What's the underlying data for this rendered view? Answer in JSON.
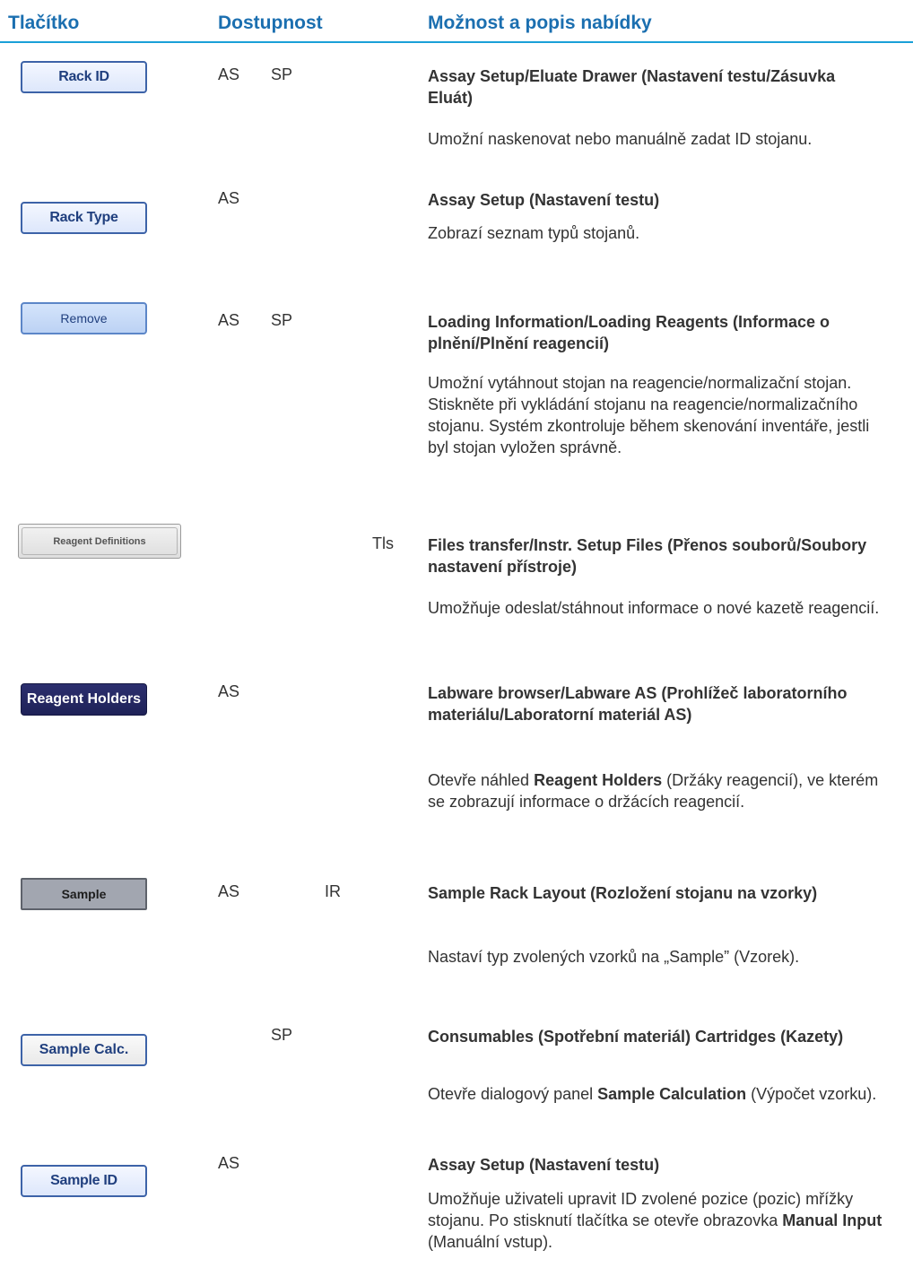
{
  "header": {
    "col_button": "Tlačítko",
    "col_availability": "Dostupnost",
    "col_menu": "Možnost a popis nabídky"
  },
  "rows": [
    {
      "button": "Rack ID",
      "a1": "AS",
      "a2": "SP",
      "a3": "",
      "a4": "",
      "menu": "Assay Setup/Eluate Drawer (Nastavení testu/Zásuvka Eluát)",
      "desc": "Umožní naskenovat nebo manuálně zadat ID stojanu."
    },
    {
      "button": "Rack Type",
      "a1": "AS",
      "a2": "",
      "a3": "",
      "a4": "",
      "menu": "Assay Setup (Nastavení testu)",
      "desc": "Zobrazí seznam typů stojanů."
    },
    {
      "button": "Remove",
      "a1": "AS",
      "a2": "SP",
      "a3": "",
      "a4": "",
      "menu": "Loading Information/Loading Reagents (Informace o plnění/Plnění reagencií)",
      "desc": "Umožní vytáhnout stojan na reagencie/normalizační stojan. Stiskněte při vykládání stojanu na reagencie/normalizačního stojanu. Systém zkontroluje během skenování inventáře, jestli byl stojan vyložen správně."
    },
    {
      "button": "Reagent Definitions",
      "a1": "",
      "a2": "",
      "a3": "",
      "a4": "Tls",
      "menu": "Files transfer/Instr. Setup Files (Přenos souborů/Soubory nastavení přístroje)",
      "desc": "Umožňuje odeslat/stáhnout informace o nové kazetě reagencií."
    },
    {
      "button": "Reagent Holders",
      "a1": "AS",
      "a2": "",
      "a3": "",
      "a4": "",
      "menu": "Labware browser/Labware AS (Prohlížeč laboratorního materiálu/Laboratorní materiál AS)",
      "desc_pre": "Otevře náhled ",
      "desc_bold": "Reagent Holders",
      "desc_post": " (Držáky reagencií), ve kterém se zobrazují informace o držácích reagencií."
    },
    {
      "button": "Sample",
      "a1": "AS",
      "a2": "",
      "a3": "IR",
      "a4": "",
      "menu": "Sample Rack Layout (Rozložení stojanu na vzorky)",
      "desc": "Nastaví typ zvolených vzorků na „Sample” (Vzorek)."
    },
    {
      "button": "Sample Calc.",
      "a1": "",
      "a2": "SP",
      "a3": "",
      "a4": "",
      "menu": "Consumables (Spotřební materiál) Cartridges (Kazety)",
      "desc_pre": "Otevře dialogový panel ",
      "desc_bold": "Sample Calculation",
      "desc_post": " (Výpočet vzorku)."
    },
    {
      "button": "Sample ID",
      "a1": "AS",
      "a2": "",
      "a3": "",
      "a4": "",
      "menu": "Assay Setup (Nastavení testu)",
      "desc_pre": "Umožňuje uživateli upravit ID zvolené pozice (pozic) mřížky stojanu. Po stisknutí tlačítka se otevře obrazovka ",
      "desc_bold": "Manual Input",
      "desc_post": " (Manuální vstup)."
    }
  ]
}
